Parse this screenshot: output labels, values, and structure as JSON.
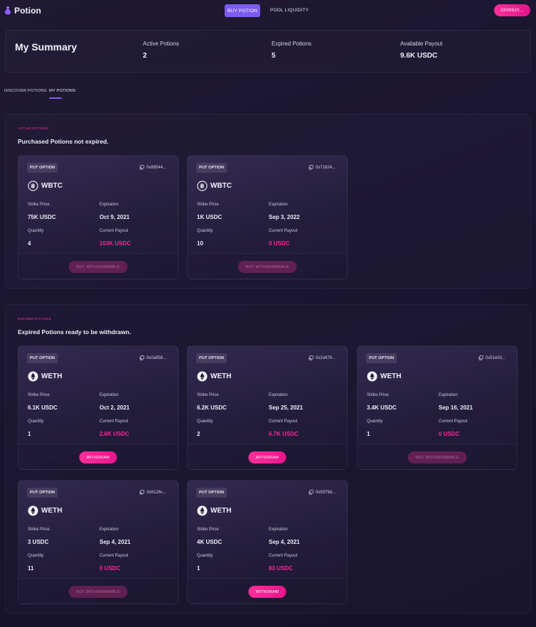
{
  "app": {
    "name": "Potion"
  },
  "nav": {
    "buy_label": "BUY POTION",
    "pool_label": "POOL LIQUIDITY"
  },
  "wallet": {
    "label": "0X09610..."
  },
  "summary": {
    "title": "My Summary",
    "stats": [
      {
        "label": "Active Potions",
        "value": "2"
      },
      {
        "label": "Expired Potions",
        "value": "5"
      },
      {
        "label": "Available Payout",
        "value": "9.6K USDC"
      }
    ]
  },
  "tabs": [
    {
      "label": "DISCOVER POTIONS",
      "active": false
    },
    {
      "label": "MY POTIONS",
      "active": true
    }
  ],
  "labels": {
    "badge": "PUT OPTION",
    "strike": "Strike Price",
    "expiration": "Expiration",
    "quantity": "Quantity",
    "payout": "Current Payout",
    "withdraw": "WITHDRAW",
    "not_withdrawable": "NOT WITHDRAWABLE"
  },
  "active_section": {
    "kicker": "ACTIVE POTIONS",
    "title": "Purchased Potions not expired."
  },
  "expired_section": {
    "kicker": "EXPIRED POTIONS",
    "title": "Expired Potions ready to be withdrawn."
  },
  "active_cards": [
    {
      "addr": "0x88544...",
      "asset": "WBTC",
      "asset_icon": "bitcoin-icon",
      "strike": "75K USDC",
      "expiration": "Oct 9, 2021",
      "quantity": "4",
      "payout": "103K USDC",
      "action": "not_withdrawable"
    },
    {
      "addr": "0x71824...",
      "asset": "WBTC",
      "asset_icon": "bitcoin-icon",
      "strike": "1K USDC",
      "expiration": "Sep 3, 2022",
      "quantity": "10",
      "payout": "0 USDC",
      "action": "not_withdrawable"
    }
  ],
  "expired_cards": [
    {
      "addr": "0x0a958...",
      "asset": "WETH",
      "asset_icon": "ethereum-icon",
      "strike": "6.1K USDC",
      "expiration": "Oct 2, 2021",
      "quantity": "1",
      "payout": "2.6K USDC",
      "action": "withdraw"
    },
    {
      "addr": "0x2d479...",
      "asset": "WETH",
      "asset_icon": "ethereum-icon",
      "strike": "6.2K USDC",
      "expiration": "Sep 25, 2021",
      "quantity": "2",
      "payout": "6.7K USDC",
      "action": "withdraw"
    },
    {
      "addr": "0x51e03...",
      "asset": "WETH",
      "asset_icon": "ethereum-icon",
      "strike": "3.4K USDC",
      "expiration": "Sep 16, 2021",
      "quantity": "1",
      "payout": "0 USDC",
      "action": "not_withdrawable"
    },
    {
      "addr": "0x8126c...",
      "asset": "WETH",
      "asset_icon": "ethereum-icon",
      "strike": "3 USDC",
      "expiration": "Sep 4, 2021",
      "quantity": "11",
      "payout": "0 USDC",
      "action": "not_withdrawable"
    },
    {
      "addr": "0x5979d...",
      "asset": "WETH",
      "asset_icon": "ethereum-icon",
      "strike": "4K USDC",
      "expiration": "Sep 4, 2021",
      "quantity": "1",
      "payout": "83 USDC",
      "action": "withdraw"
    }
  ],
  "colors": {
    "accent": "#7c5cf0",
    "pink": "#ff2596",
    "background": "#1c172f"
  }
}
